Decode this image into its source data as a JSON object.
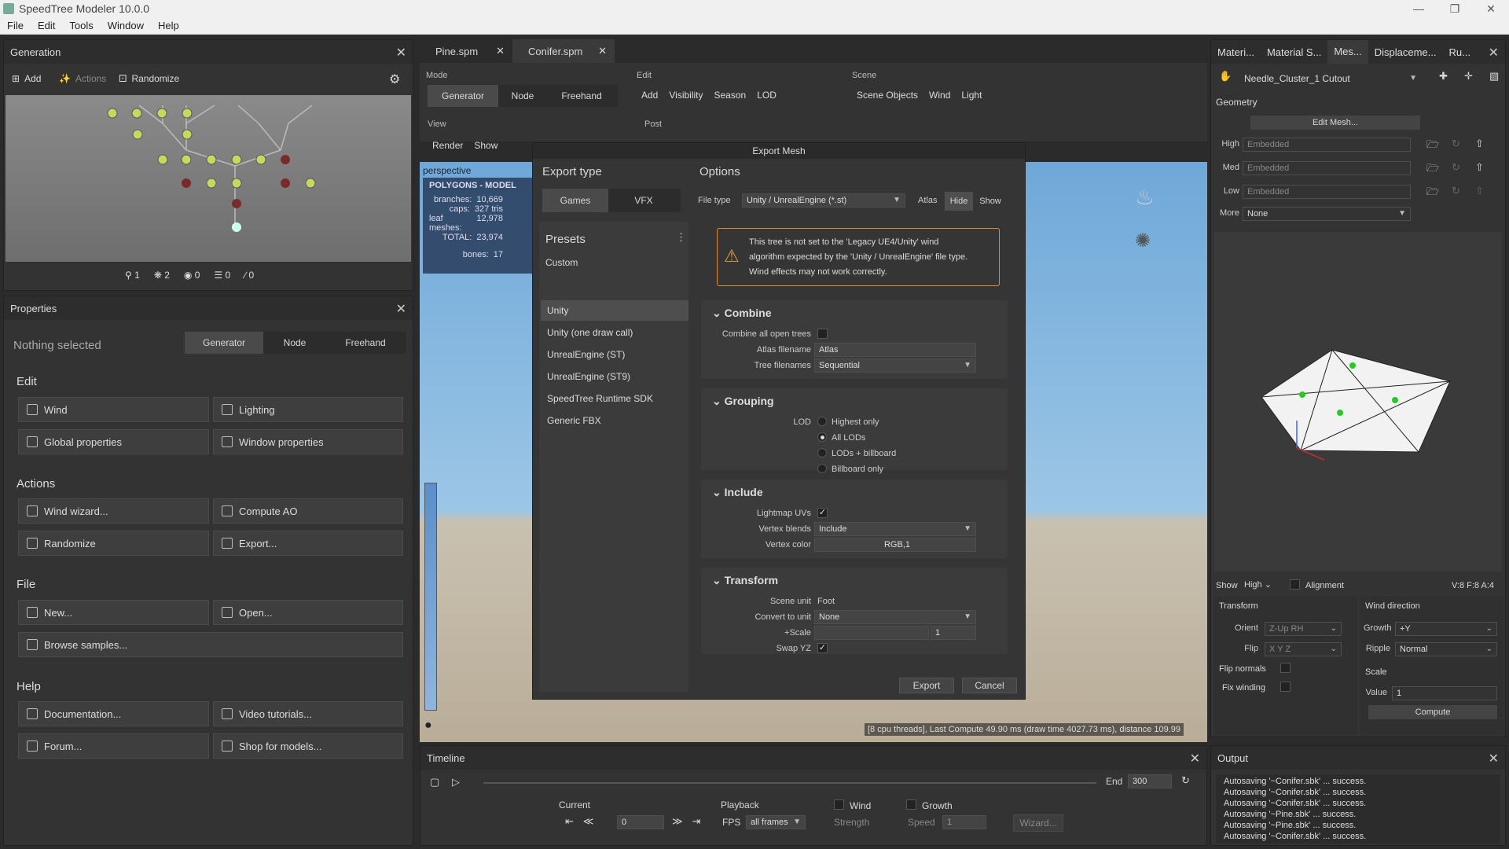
{
  "app": {
    "title": "SpeedTree Modeler 10.0.0",
    "menu": [
      "File",
      "Edit",
      "Tools",
      "Window",
      "Help"
    ]
  },
  "generation": {
    "title": "Generation",
    "add": "Add",
    "actions": "Actions",
    "randomize": "Randomize",
    "counts": [
      "1",
      "2",
      "0",
      "0",
      "0"
    ]
  },
  "properties": {
    "title": "Properties",
    "nothing": "Nothing selected",
    "modes": [
      "Generator",
      "Node",
      "Freehand"
    ],
    "edit_title": "Edit",
    "edit": [
      "Wind",
      "Lighting",
      "Global properties",
      "Window properties"
    ],
    "actions_title": "Actions",
    "actions": [
      "Wind wizard...",
      "Compute AO",
      "Randomize",
      "Export..."
    ],
    "file_title": "File",
    "file": [
      "New...",
      "Open...",
      "Browse samples..."
    ],
    "help_title": "Help",
    "help": [
      "Documentation...",
      "Video tutorials...",
      "Forum...",
      "Shop for models..."
    ]
  },
  "tabs": [
    "Pine.spm",
    "Conifer.spm"
  ],
  "toolbar": {
    "mode": "Mode",
    "modes": [
      "Generator",
      "Node",
      "Freehand"
    ],
    "edit": "Edit",
    "edit_items": [
      "Add",
      "Visibility",
      "Season",
      "LOD"
    ],
    "scene": "Scene",
    "scene_items": [
      "Scene Objects",
      "Wind",
      "Light"
    ],
    "view": "View",
    "view_items": [
      "Render",
      "Show"
    ],
    "post": "Post"
  },
  "viewport": {
    "label": "perspective",
    "stats_title": "POLYGONS - MODEL",
    "stats": [
      [
        "branches:",
        "10,669"
      ],
      [
        "caps:",
        "327 tris"
      ],
      [
        "leaf meshes:",
        "12,978"
      ],
      [
        "TOTAL:",
        "23,974"
      ],
      [
        "bones:",
        "17"
      ]
    ],
    "status": "[8 cpu threads], Last Compute 49.90 ms (draw time 4027.73 ms), distance 109.99"
  },
  "dialog": {
    "title": "Export Mesh",
    "export_type": "Export type",
    "games": "Games",
    "vfx": "VFX",
    "presets": "Presets",
    "custom": "Custom",
    "preset_items": [
      "Unity",
      "Unity (one draw call)",
      "UnrealEngine (ST)",
      "UnrealEngine (ST9)",
      "SpeedTree Runtime SDK",
      "Generic FBX"
    ],
    "options": "Options",
    "file_type_label": "File type",
    "file_type": "Unity / UnrealEngine (*.st)",
    "atlas": "Atlas",
    "hide": "Hide",
    "show": "Show",
    "warning": [
      "This tree is not set to the 'Legacy UE4/Unity' wind",
      "algorithm expected by the 'Unity / UnrealEngine' file type.",
      "Wind effects may not work correctly."
    ],
    "combine": "Combine",
    "combine_all": "Combine all open trees",
    "atlas_filename_label": "Atlas filename",
    "atlas_filename": "Atlas",
    "tree_filenames_label": "Tree filenames",
    "tree_filenames": "Sequential",
    "grouping": "Grouping",
    "lod": "LOD",
    "lod_options": [
      "Highest only",
      "All LODs",
      "LODs + billboard",
      "Billboard only"
    ],
    "include": "Include",
    "lightmap": "Lightmap UVs",
    "vertex_blends_label": "Vertex blends",
    "vertex_blends": "Include",
    "vertex_color_label": "Vertex color",
    "vertex_color": "RGB,1",
    "transform": "Transform",
    "scene_unit_label": "Scene unit",
    "scene_unit": "Foot",
    "convert_label": "Convert to unit",
    "convert": "None",
    "scale_label": "+Scale",
    "scale": "1",
    "swap_label": "Swap YZ",
    "export": "Export",
    "cancel": "Cancel"
  },
  "timeline": {
    "title": "Timeline",
    "end_label": "End",
    "end": "300",
    "current": "Current",
    "current_val": "0",
    "playback": "Playback",
    "fps": "FPS",
    "fps_val": "all frames",
    "wind": "Wind",
    "strength": "Strength",
    "growth": "Growth",
    "speed": "Speed",
    "speed_val": "1",
    "wizard": "Wizard..."
  },
  "right": {
    "tabs": [
      "Materi...",
      "Material S...",
      "Mes...",
      "Displaceme...",
      "Ru..."
    ],
    "mesh": "Needle_Cluster_1 Cutout",
    "geometry": "Geometry",
    "edit_mesh": "Edit Mesh...",
    "lods": [
      [
        "High",
        "Embedded"
      ],
      [
        "Med",
        "Embedded"
      ],
      [
        "Low",
        "Embedded"
      ]
    ],
    "more_label": "More",
    "more": "None",
    "show": "Show",
    "show_val": "High",
    "alignment": "Alignment",
    "counts": "V:8  F:8  A:4",
    "transform": "Transform",
    "orient_label": "Orient",
    "orient": "Z-Up RH",
    "flip_label": "Flip",
    "flip": "X Y Z",
    "flip_normals": "Flip normals",
    "fix_winding": "Fix winding",
    "wind_dir": "Wind direction",
    "growth_label": "Growth",
    "growth": "+Y",
    "ripple_label": "Ripple",
    "ripple": "Normal",
    "scale": "Scale",
    "value_label": "Value",
    "value": "1",
    "compute": "Compute"
  },
  "output": {
    "title": "Output",
    "lines": [
      "Autosaving '~Conifer.sbk' ... success.",
      "Autosaving '~Conifer.sbk' ... success.",
      "Autosaving '~Conifer.sbk' ... success.",
      "Autosaving '~Pine.sbk' ... success.",
      "Autosaving '~Pine.sbk' ... success.",
      "Autosaving '~Conifer.sbk' ... success."
    ]
  }
}
